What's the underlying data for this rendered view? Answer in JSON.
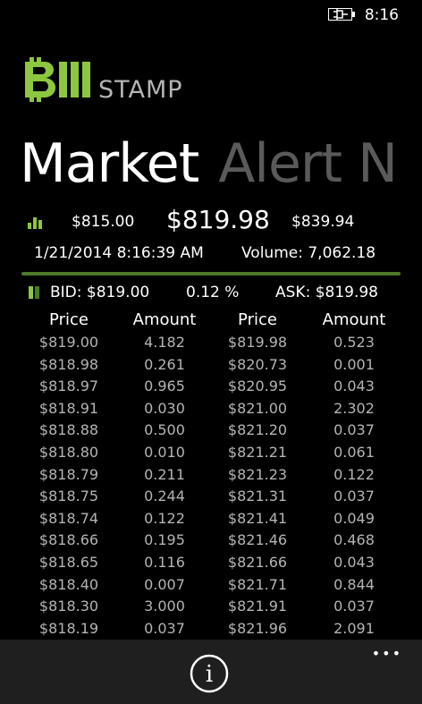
{
  "status": {
    "time": "8:16"
  },
  "brand": {
    "name_rest": "STAMP"
  },
  "pivot": {
    "active": "Market",
    "next": "Alert N"
  },
  "ticker": {
    "low": "$815.00",
    "last": "$819.98",
    "high": "$839.94",
    "datetime": "1/21/2014 8:16:39 AM",
    "volume": "Volume: 7,062.18"
  },
  "summary": {
    "bid": "BID: $819.00",
    "spread": "0.12 %",
    "ask": "ASK: $819.98"
  },
  "orderbook": {
    "headers": [
      "Price",
      "Amount",
      "Price",
      "Amount"
    ],
    "rows": [
      [
        "$819.00",
        "4.182",
        "$819.98",
        "0.523"
      ],
      [
        "$818.98",
        "0.261",
        "$820.73",
        "0.001"
      ],
      [
        "$818.97",
        "0.965",
        "$820.95",
        "0.043"
      ],
      [
        "$818.91",
        "0.030",
        "$821.00",
        "2.302"
      ],
      [
        "$818.88",
        "0.500",
        "$821.20",
        "0.037"
      ],
      [
        "$818.80",
        "0.010",
        "$821.21",
        "0.061"
      ],
      [
        "$818.79",
        "0.211",
        "$821.23",
        "0.122"
      ],
      [
        "$818.75",
        "0.244",
        "$821.31",
        "0.037"
      ],
      [
        "$818.74",
        "0.122",
        "$821.41",
        "0.049"
      ],
      [
        "$818.66",
        "0.195",
        "$821.46",
        "0.468"
      ],
      [
        "$818.65",
        "0.116",
        "$821.66",
        "0.043"
      ],
      [
        "$818.40",
        "0.007",
        "$821.71",
        "0.844"
      ],
      [
        "$818.30",
        "3.000",
        "$821.91",
        "0.037"
      ],
      [
        "$818.19",
        "0.037",
        "$821.96",
        "2.091"
      ]
    ]
  },
  "appbar": {
    "info_label": "i",
    "more_label": "•••"
  },
  "colors": {
    "accent": "#8dc63f",
    "divider": "#4c7a27",
    "appbar": "#1f1f1f"
  },
  "icons": [
    "battery-charging-icon",
    "bitcoin-b-logo",
    "bar-chart-icon",
    "order-book-icon",
    "info-icon",
    "ellipsis-icon"
  ]
}
